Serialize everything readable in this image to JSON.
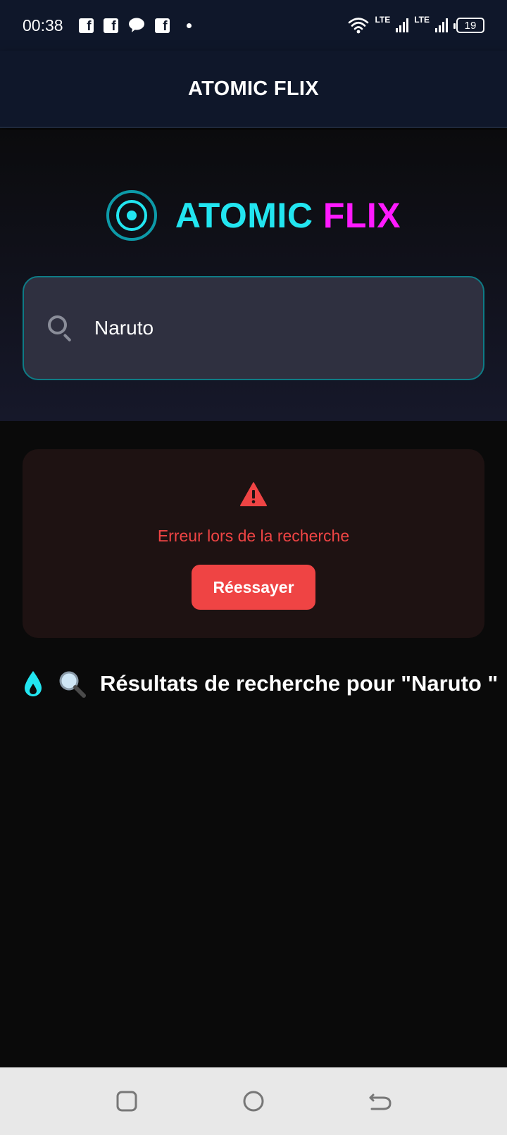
{
  "status_bar": {
    "time": "00:38",
    "lte1": "LTE",
    "lte2": "LTE",
    "battery": "19"
  },
  "header": {
    "title": "ATOMIC FLIX"
  },
  "brand": {
    "word1": "ATOMIC",
    "word2": "FLIX",
    "color1": "#22e5f0",
    "color2": "#ff1aff"
  },
  "search": {
    "value": "Naruto"
  },
  "error": {
    "message": "Erreur lors de la recherche",
    "retry_label": "Réessayer",
    "color": "#ef4444"
  },
  "results": {
    "heading": "Résultats de recherche pour \"Naruto \""
  }
}
